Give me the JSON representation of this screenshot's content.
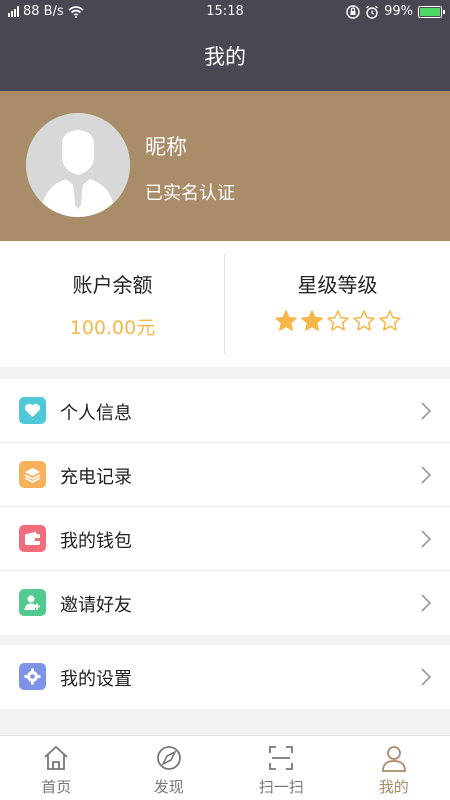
{
  "status_bar": {
    "network_speed": "88 B/s",
    "time": "15:18",
    "battery": "99%",
    "battery_level": 0.99
  },
  "header": {
    "title": "我的"
  },
  "profile": {
    "nickname": "昵称",
    "verification": "已实名认证"
  },
  "stats": {
    "balance_label": "账户余额",
    "balance_value": "100.00元",
    "level_label": "星级等级",
    "level_stars_filled": 2,
    "level_stars_total": 5,
    "star_color": "#f6b64a"
  },
  "menu": {
    "items": [
      {
        "label": "个人信息",
        "icon": "heart-icon",
        "color": "#4fc8d7"
      },
      {
        "label": "充电记录",
        "icon": "layers-icon",
        "color": "#f6b15b"
      },
      {
        "label": "我的钱包",
        "icon": "wallet-icon",
        "color": "#ef6d7d"
      },
      {
        "label": "邀请好友",
        "icon": "user-add-icon",
        "color": "#52c98f"
      }
    ],
    "settings": {
      "label": "我的设置",
      "icon": "gear-icon",
      "color": "#7f93e6"
    }
  },
  "tabs": [
    {
      "label": "首页",
      "icon": "home-icon",
      "active": false
    },
    {
      "label": "发现",
      "icon": "compass-icon",
      "active": false
    },
    {
      "label": "扫一扫",
      "icon": "scan-icon",
      "active": false
    },
    {
      "label": "我的",
      "icon": "person-icon",
      "active": true
    }
  ],
  "colors": {
    "header_bg": "#4a4752",
    "profile_bg": "#a98d68",
    "accent": "#a98d68",
    "balance": "#f6b64a"
  }
}
